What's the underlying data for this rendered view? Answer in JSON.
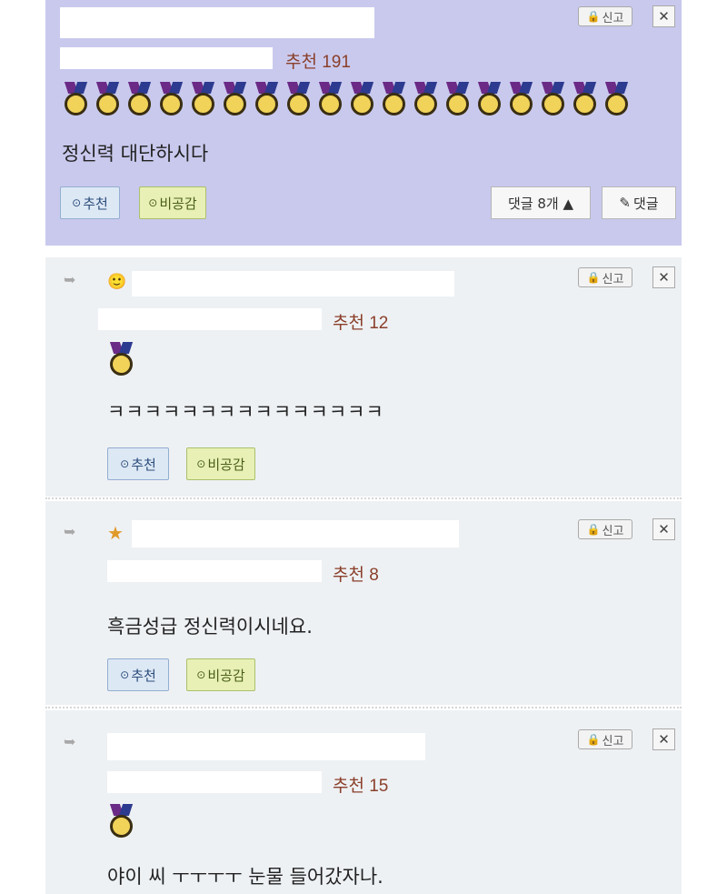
{
  "comments": [
    {
      "recommend_label": "추천 191",
      "medal_count": 18,
      "body": "정신력 대단하시다",
      "vote_up_label": "추천",
      "vote_down_label": "비공감",
      "replies_label": "댓글 8개 ▲",
      "reply_label": "댓글",
      "report_label": "신고",
      "close_label": "✕"
    },
    {
      "recommend_label": "추천 12",
      "medal_count": 1,
      "body": "ㅋㅋㅋㅋㅋㅋㅋㅋㅋㅋㅋㅋㅋㅋㅋ",
      "vote_up_label": "추천",
      "vote_down_label": "비공감",
      "report_label": "신고",
      "close_label": "✕"
    },
    {
      "recommend_label": "추천 8",
      "medal_count": 0,
      "body": "흑금성급 정신력이시네요.",
      "vote_up_label": "추천",
      "vote_down_label": "비공감",
      "report_label": "신고",
      "close_label": "✕"
    },
    {
      "recommend_label": "추천 15",
      "medal_count": 1,
      "body": "야이 씨 ㅜㅜㅜㅜ  눈물 들어갔자나.",
      "report_label": "신고",
      "close_label": "✕"
    }
  ],
  "icons": {
    "reply_arrow": "reply-arrow-icon",
    "lock": "lock-icon",
    "star": "star-icon",
    "medal": "medal-icon",
    "pen": "pen-icon",
    "vote": "circle-icon"
  },
  "colors": {
    "best_bg": "#c9c9ee",
    "reply_bg": "#eef1f4",
    "recommend_text": "#8a3f2a"
  }
}
